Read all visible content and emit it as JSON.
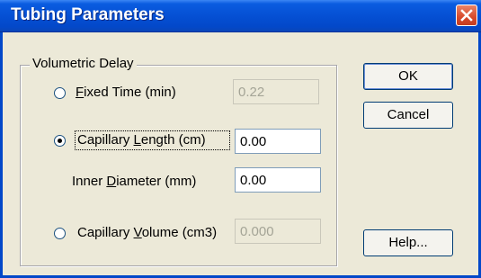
{
  "window": {
    "title": "Tubing Parameters"
  },
  "group": {
    "label": "Volumetric Delay"
  },
  "options": {
    "fixed_time": {
      "label_prefix": "",
      "label_mnemonic": "F",
      "label_rest": "ixed Time (min)",
      "value": "0.22",
      "selected": false,
      "enabled": false
    },
    "capillary_length": {
      "label_prefix": "Capillary ",
      "label_mnemonic": "L",
      "label_rest": "ength (cm)",
      "value": "0.00",
      "selected": true,
      "enabled": true
    },
    "inner_diameter": {
      "label_prefix": "Inner ",
      "label_mnemonic": "D",
      "label_rest": "iameter (mm)",
      "value": "0.00",
      "enabled": true
    },
    "capillary_volume": {
      "label_prefix": "Capillary ",
      "label_mnemonic": "V",
      "label_rest": "olume (cm3)",
      "value": "0.000",
      "selected": false,
      "enabled": false
    }
  },
  "buttons": {
    "ok": "OK",
    "cancel": "Cancel",
    "help": "Help..."
  },
  "icons": {
    "close": "close-icon"
  }
}
